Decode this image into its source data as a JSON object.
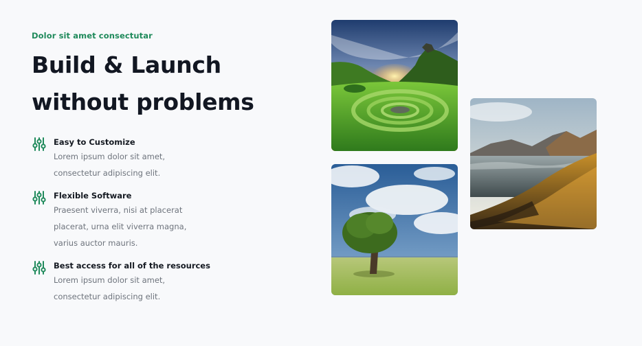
{
  "hero": {
    "eyebrow": "Dolor sit amet consectutar",
    "headline_line1": "Build & Launch",
    "headline_line2": "without problems"
  },
  "features": [
    {
      "icon": "sliders-icon",
      "title": "Easy to Customize",
      "description": "Lorem ipsum dolor sit amet, consectetur adipiscing elit."
    },
    {
      "icon": "sliders-icon",
      "title": "Flexible Software",
      "description": "Praesent viverra, nisi at placerat placerat, urna elit viverra magna, varius auctor mauris."
    },
    {
      "icon": "sliders-icon",
      "title": "Best access for all of the resources",
      "description": "Lorem ipsum dolor sit amet, consectetur adipiscing elit."
    }
  ],
  "photos": [
    "green-valley-stone-circle",
    "lone-tree-cloudy-sky",
    "mountain-lake-sunset"
  ],
  "colors": {
    "accent": "#1f8a5b",
    "heading": "#121722",
    "body_text": "#6d737c",
    "background": "#f8f9fb"
  }
}
